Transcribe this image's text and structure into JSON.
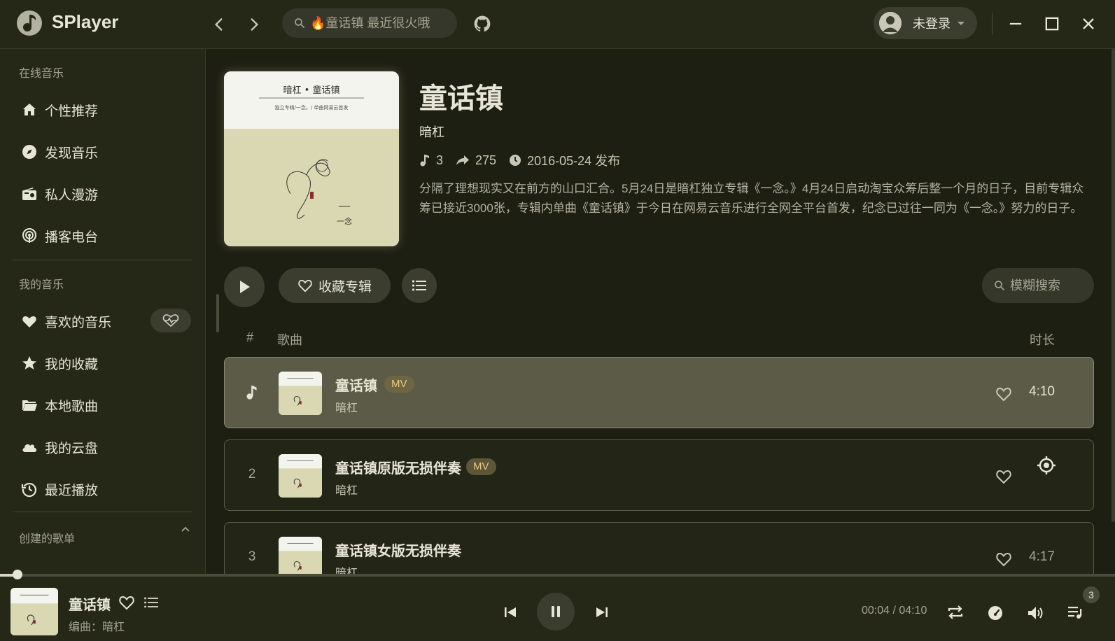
{
  "app": {
    "name": "SPlayer"
  },
  "search": {
    "placeholder": "🔥童话镇 最近很火哦"
  },
  "user": {
    "name": "未登录"
  },
  "sidebar": {
    "online_header": "在线音乐",
    "online_items": [
      {
        "label": "个性推荐",
        "icon": "home-icon"
      },
      {
        "label": "发现音乐",
        "icon": "compass-icon"
      },
      {
        "label": "私人漫游",
        "icon": "radio-icon"
      },
      {
        "label": "播客电台",
        "icon": "podcast-icon"
      }
    ],
    "my_header": "我的音乐",
    "my_items": [
      {
        "label": "喜欢的音乐",
        "icon": "heart-icon"
      },
      {
        "label": "我的收藏",
        "icon": "star-icon"
      },
      {
        "label": "本地歌曲",
        "icon": "folder-icon"
      },
      {
        "label": "我的云盘",
        "icon": "cloud-icon"
      },
      {
        "label": "最近播放",
        "icon": "history-icon"
      }
    ],
    "playlist_header": "创建的歌单"
  },
  "album": {
    "title": "童话镇",
    "artist": "暗杠",
    "track_count": "3",
    "share_count": "275",
    "release": "2016-05-24 发布",
    "description": "分隔了理想现实又在前方的山口汇合。5月24日是暗杠独立专辑《一念。》4月24日启动淘宝众筹后整一个月的日子，目前专辑众筹已接近3000张，专辑内单曲《童话镇》于今日在网易云音乐进行全网全平台首发，纪念已过往一同为《一念。》努力的日子。",
    "cover_title": "暗杠 • 童话镇",
    "cover_subtitle": "独立专辑/一念。/ 单曲网易云首发",
    "cover_logo": "一念"
  },
  "actions": {
    "favorite_label": "收藏专辑",
    "fuzzy_placeholder": "模糊搜索"
  },
  "table": {
    "headers": {
      "index": "#",
      "song": "歌曲",
      "duration": "时长"
    },
    "rows": [
      {
        "index": "",
        "title": "童话镇",
        "mv": "MV",
        "artist": "暗杠",
        "duration": "4:10",
        "active": true
      },
      {
        "index": "2",
        "title": "童话镇原版无损伴奏",
        "mv": "MV",
        "artist": "暗杠",
        "duration": "",
        "active": false
      },
      {
        "index": "3",
        "title": "童话镇女版无损伴奏",
        "mv": "",
        "artist": "暗杠",
        "duration": "4:17",
        "active": false
      }
    ]
  },
  "player": {
    "title": "童话镇",
    "subtitle": "编曲：暗杠",
    "time": "00:04 / 04:10",
    "progress": 0.016,
    "queue_count": "3"
  },
  "colors": {
    "background": "#1e1f13",
    "panel": "#262817",
    "accent": "#e6e5d6",
    "mv_badge": "#e5c98a"
  }
}
